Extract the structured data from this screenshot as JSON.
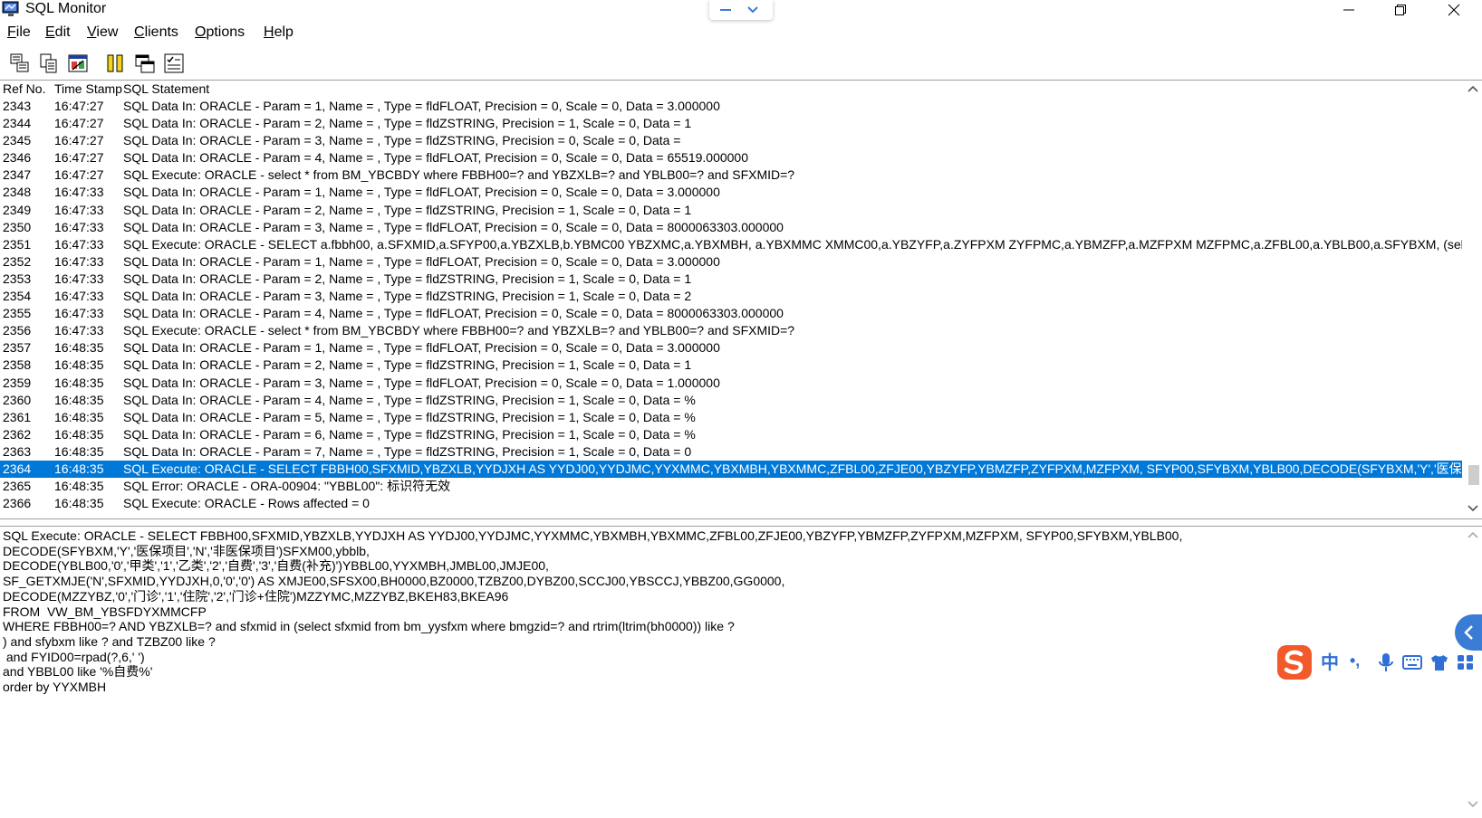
{
  "window": {
    "title": "SQL Monitor",
    "icons": [
      "app-monitor-icon",
      "minimize-icon",
      "restore-icon",
      "close-icon"
    ]
  },
  "ime_float": {
    "icons": [
      "dash-icon",
      "chevron-down-icon"
    ]
  },
  "menu": [
    {
      "label": "File",
      "mnemonic": "F",
      "rest": "ile"
    },
    {
      "label": "Edit",
      "mnemonic": "E",
      "rest": "dit"
    },
    {
      "label": "View",
      "mnemonic": "V",
      "rest": "iew"
    },
    {
      "label": "Clients",
      "mnemonic": "C",
      "rest": "lients"
    },
    {
      "label": "Options",
      "mnemonic": "O",
      "rest": "ptions"
    },
    {
      "label": "Help",
      "mnemonic": "H",
      "rest": "elp"
    }
  ],
  "toolbar": {
    "icons": [
      "save-log-icon",
      "copy-icon",
      "clear-icon",
      "pause-icon",
      "window-icon",
      "options-check-icon"
    ]
  },
  "log": {
    "columns": [
      "Ref No.",
      "Time Stamp",
      "SQL Statement"
    ],
    "selected_ref": "2364",
    "rows": [
      {
        "ref": "2343",
        "ts": "16:47:27",
        "sql": "SQL Data In: ORACLE - Param = 1, Name = , Type = fldFLOAT, Precision = 0, Scale = 0, Data = 3.000000"
      },
      {
        "ref": "2344",
        "ts": "16:47:27",
        "sql": "SQL Data In: ORACLE - Param = 2, Name = , Type = fldZSTRING, Precision = 1, Scale = 0, Data = 1"
      },
      {
        "ref": "2345",
        "ts": "16:47:27",
        "sql": "SQL Data In: ORACLE - Param = 3, Name = , Type = fldZSTRING, Precision = 0, Scale = 0, Data ="
      },
      {
        "ref": "2346",
        "ts": "16:47:27",
        "sql": "SQL Data In: ORACLE - Param = 4, Name = , Type = fldFLOAT, Precision = 0, Scale = 0, Data = 65519.000000"
      },
      {
        "ref": "2347",
        "ts": "16:47:27",
        "sql": "SQL Execute: ORACLE -  select * from BM_YBCBDY where FBBH00=? and YBZXLB=? and YBLB00=? and SFXMID=?"
      },
      {
        "ref": "2348",
        "ts": "16:47:33",
        "sql": "SQL Data In: ORACLE - Param = 1, Name = , Type = fldFLOAT, Precision = 0, Scale = 0, Data = 3.000000"
      },
      {
        "ref": "2349",
        "ts": "16:47:33",
        "sql": "SQL Data In: ORACLE - Param = 2, Name = , Type = fldZSTRING, Precision = 1, Scale = 0, Data = 1"
      },
      {
        "ref": "2350",
        "ts": "16:47:33",
        "sql": "SQL Data In: ORACLE - Param = 3, Name = , Type = fldFLOAT, Precision = 0, Scale = 0, Data = 8000063303.000000"
      },
      {
        "ref": "2351",
        "ts": "16:47:33",
        "sql": "SQL Execute: ORACLE -  SELECT a.fbbh00, a.SFXMID,a.SFYP00,a.YBZXLB,b.YBMC00 YBZXMC,a.YBXMBH, a.YBXMMC XMMC00,a.YBZYFP,a.ZYFPXM ZYFPMC,a.YBMZFP,a.MZFPXM MZFPMC,a.ZFBL00,a.YBLB00,a.SFYBXM, (select YI"
      },
      {
        "ref": "2352",
        "ts": "16:47:33",
        "sql": "SQL Data In: ORACLE - Param = 1, Name = , Type = fldFLOAT, Precision = 0, Scale = 0, Data = 3.000000"
      },
      {
        "ref": "2353",
        "ts": "16:47:33",
        "sql": "SQL Data In: ORACLE - Param = 2, Name = , Type = fldZSTRING, Precision = 1, Scale = 0, Data = 1"
      },
      {
        "ref": "2354",
        "ts": "16:47:33",
        "sql": "SQL Data In: ORACLE - Param = 3, Name = , Type = fldZSTRING, Precision = 1, Scale = 0, Data = 2"
      },
      {
        "ref": "2355",
        "ts": "16:47:33",
        "sql": "SQL Data In: ORACLE - Param = 4, Name = , Type = fldFLOAT, Precision = 0, Scale = 0, Data = 8000063303.000000"
      },
      {
        "ref": "2356",
        "ts": "16:47:33",
        "sql": "SQL Execute: ORACLE -  select * from BM_YBCBDY where FBBH00=? and YBZXLB=? and YBLB00=? and SFXMID=?"
      },
      {
        "ref": "2357",
        "ts": "16:48:35",
        "sql": "SQL Data In: ORACLE - Param = 1, Name = , Type = fldFLOAT, Precision = 0, Scale = 0, Data = 3.000000"
      },
      {
        "ref": "2358",
        "ts": "16:48:35",
        "sql": "SQL Data In: ORACLE - Param = 2, Name = , Type = fldZSTRING, Precision = 1, Scale = 0, Data = 1"
      },
      {
        "ref": "2359",
        "ts": "16:48:35",
        "sql": "SQL Data In: ORACLE - Param = 3, Name = , Type = fldFLOAT, Precision = 0, Scale = 0, Data = 1.000000"
      },
      {
        "ref": "2360",
        "ts": "16:48:35",
        "sql": "SQL Data In: ORACLE - Param = 4, Name = , Type = fldZSTRING, Precision = 1, Scale = 0, Data = %"
      },
      {
        "ref": "2361",
        "ts": "16:48:35",
        "sql": "SQL Data In: ORACLE - Param = 5, Name = , Type = fldZSTRING, Precision = 1, Scale = 0, Data = %"
      },
      {
        "ref": "2362",
        "ts": "16:48:35",
        "sql": "SQL Data In: ORACLE - Param = 6, Name = , Type = fldZSTRING, Precision = 1, Scale = 0, Data = %"
      },
      {
        "ref": "2363",
        "ts": "16:48:35",
        "sql": "SQL Data In: ORACLE - Param = 7, Name = , Type = fldZSTRING, Precision = 1, Scale = 0, Data = 0"
      },
      {
        "ref": "2364",
        "ts": "16:48:35",
        "sql": "SQL Execute: ORACLE - SELECT FBBH00,SFXMID,YBZXLB,YYDJXH AS YYDJ00,YYDJMC,YYXMMC,YBXMBH,YBXMMC,ZFBL00,ZFJE00,YBZYFP,YBMZFP,ZYFPXM,MZFPXM, SFYP00,SFYBXM,YBLB00,DECODE(SFYBXM,'Y','医保项目','"
      },
      {
        "ref": "2365",
        "ts": "16:48:35",
        "sql": "SQL Error: ORACLE - ORA-00904: \"YBBL00\": 标识符无效"
      },
      {
        "ref": "2366",
        "ts": "16:48:35",
        "sql": "SQL Execute: ORACLE - Rows affected = 0"
      }
    ],
    "scroll_position": 0.97
  },
  "detail": {
    "lines": [
      "SQL Execute: ORACLE - SELECT FBBH00,SFXMID,YBZXLB,YYDJXH AS YYDJ00,YYDJMC,YYXMMC,YBXMBH,YBXMMC,ZFBL00,ZFJE00,YBZYFP,YBMZFP,ZYFPXM,MZFPXM, SFYP00,SFYBXM,YBLB00,",
      "DECODE(SFYBXM,'Y','医保项目','N','非医保项目')SFXM00,ybblb,",
      "DECODE(YBLB00,'0','甲类','1','乙类','2','自费','3','自费(补充)')YBBL00,YYXMBH,JMBL00,JMJE00,",
      "SF_GETXMJE('N',SFXMID,YYDJXH,0,'0','0') AS XMJE00,SFSX00,BH0000,BZ0000,TZBZ00,DYBZ00,SCCJ00,YBSCCJ,YBBZ00,GG0000,",
      "DECODE(MZZYBZ,'0','门诊','1','住院','2','门诊+住院')MZZYMC,MZZYBZ,BKEH83,BKEA96",
      "FROM  VW_BM_YBSFDYXMMCFP",
      "WHERE FBBH00=? AND YBZXLB=? and sfxmid in (select sfxmid from bm_yysfxm where bmgzid=? and rtrim(ltrim(bh0000)) like ?",
      ") and sfybxm like ? and TZBZ00 like ?",
      " and FYID00=rpad(?,6,' ')",
      "and YBBL00 like '%自费%'",
      "order by YYXMBH"
    ]
  },
  "ime_toolbar": {
    "lang_label": "中",
    "punct_label": "•,",
    "icons": [
      "sogou-logo-icon",
      "microphone-icon",
      "keyboard-icon",
      "skin-shirt-icon",
      "grid-apps-icon",
      "collapse-left-icon"
    ]
  }
}
